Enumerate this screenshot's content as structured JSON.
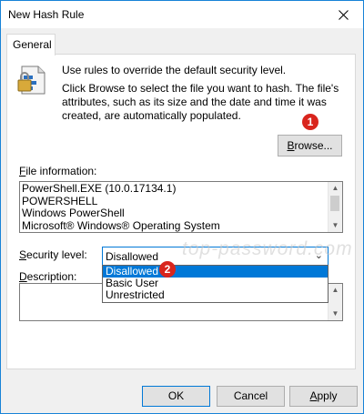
{
  "window": {
    "title": "New Hash Rule"
  },
  "tabs": [
    {
      "label": "General"
    }
  ],
  "intro": {
    "line1": "Use rules to override the default security level.",
    "line2": "Click Browse to select the file you want to hash. The file's attributes, such as its size and the date and time it was created, are automatically populated."
  },
  "browse": {
    "label_prefix": "",
    "label_underlined": "B",
    "label_rest": "rowse...",
    "badge": "1"
  },
  "file_info": {
    "label_underlined": "F",
    "label_rest": "ile information:",
    "lines": [
      "PowerShell.EXE (10.0.17134.1)",
      "POWERSHELL",
      "Windows PowerShell",
      "Microsoft® Windows® Operating System"
    ]
  },
  "security_level": {
    "label_underlined": "S",
    "label_rest": "ecurity level:",
    "selected": "Disallowed",
    "options": [
      "Disallowed",
      "Basic User",
      "Unrestricted"
    ],
    "badge": "2"
  },
  "description": {
    "label_underlined": "D",
    "label_rest": "escription:"
  },
  "watermark": "top-password.com",
  "buttons": {
    "ok": "OK",
    "cancel": "Cancel",
    "apply_underlined": "A",
    "apply_rest": "pply"
  },
  "colors": {
    "accent": "#0078d7",
    "badge": "#d9251d",
    "border": "#1883d7"
  }
}
